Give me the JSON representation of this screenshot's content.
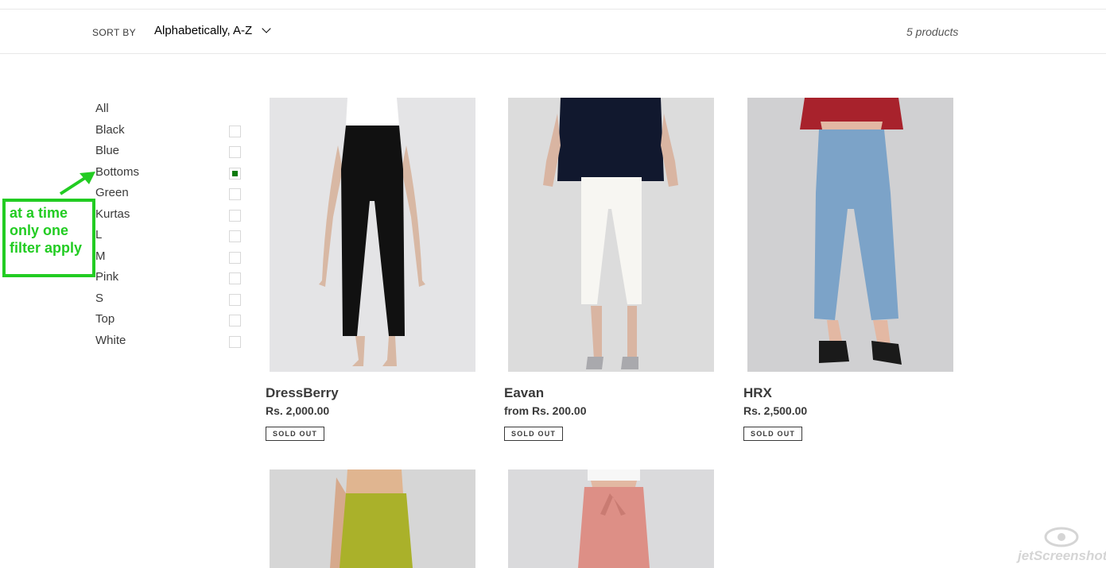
{
  "sort": {
    "label": "SORT BY",
    "selected": "Alphabetically, A-Z"
  },
  "product_count": "5 products",
  "filters": [
    {
      "label": "All",
      "checkbox": false,
      "checked": false
    },
    {
      "label": "Black",
      "checkbox": true,
      "checked": false
    },
    {
      "label": "Blue",
      "checkbox": true,
      "checked": false
    },
    {
      "label": "Bottoms",
      "checkbox": true,
      "checked": true
    },
    {
      "label": "Green",
      "checkbox": true,
      "checked": false
    },
    {
      "label": "Kurtas",
      "checkbox": true,
      "checked": false
    },
    {
      "label": "L",
      "checkbox": true,
      "checked": false
    },
    {
      "label": "M",
      "checkbox": true,
      "checked": false
    },
    {
      "label": "Pink",
      "checkbox": true,
      "checked": false
    },
    {
      "label": "S",
      "checkbox": true,
      "checked": false
    },
    {
      "label": "Top",
      "checkbox": true,
      "checked": false
    },
    {
      "label": "White",
      "checkbox": true,
      "checked": false
    }
  ],
  "annotation": {
    "text": "at a time\nonly one\nfilter apply",
    "color": "#22cc22"
  },
  "products": [
    {
      "brand": "DressBerry",
      "price": "Rs. 2,000.00",
      "badge": "SOLD OUT",
      "image": "black-pants-image"
    },
    {
      "brand": "Eavan",
      "price": "from Rs. 200.00",
      "badge": "SOLD OUT",
      "image": "white-pants-image"
    },
    {
      "brand": "HRX",
      "price": "Rs. 2,500.00",
      "badge": "SOLD OUT",
      "image": "denim-culottes-image"
    },
    {
      "brand": "",
      "price": "",
      "badge": "",
      "image": "olive-pants-image"
    },
    {
      "brand": "",
      "price": "",
      "badge": "",
      "image": "pink-pants-image"
    }
  ],
  "watermark": "jetScreenshot",
  "colors": {
    "accent_check": "#0a7a0a",
    "annotation": "#22cc22"
  }
}
